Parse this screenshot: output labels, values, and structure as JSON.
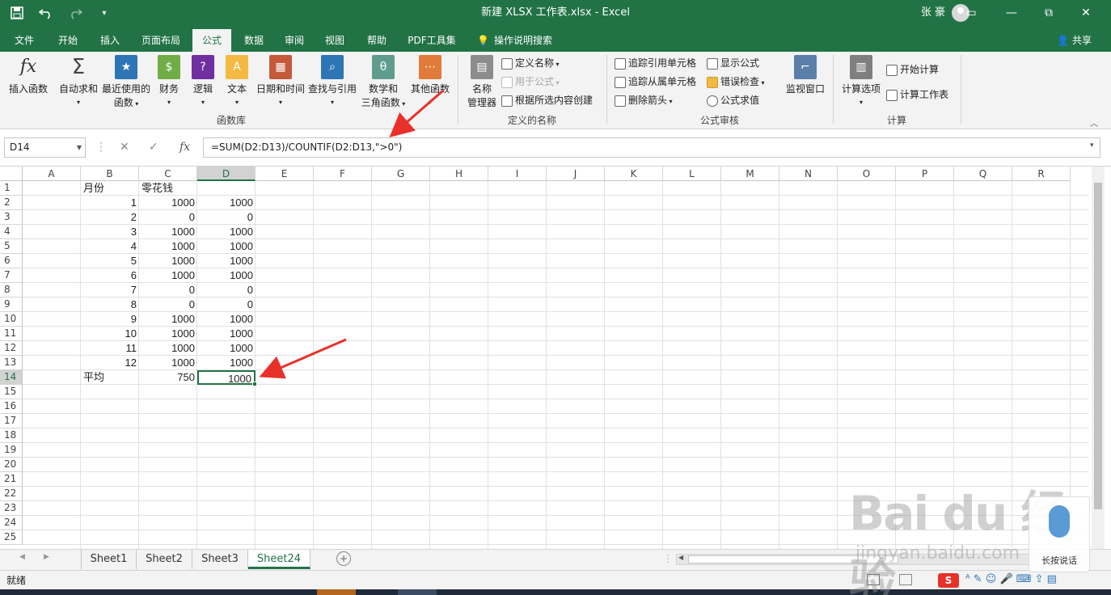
{
  "window": {
    "title": "新建 XLSX 工作表.xlsx  -  Excel",
    "user": "张 豪",
    "minimize": "—",
    "restore": "⧉",
    "close": "✕",
    "ribbon_display": "▭"
  },
  "quick_access": {
    "save_icon": "save-icon",
    "undo_icon": "undo-icon",
    "redo_icon": "redo-icon",
    "customize_icon": "customize-icon"
  },
  "tabs": [
    "文件",
    "开始",
    "插入",
    "页面布局",
    "公式",
    "数据",
    "审阅",
    "视图",
    "帮助",
    "PDF工具集",
    "操作说明搜索"
  ],
  "active_tab": "公式",
  "share": "共享",
  "ribbon": {
    "function_library": {
      "label": "函数库",
      "buttons": [
        "插入函数",
        "自动求和",
        "最近使用的\n函数",
        "财务",
        "逻辑",
        "文本",
        "日期和时间",
        "查找与引用",
        "数学和\n三角函数",
        "其他函数"
      ],
      "insert_function": "插入函数",
      "autosum": "自动求和",
      "recent_1": "最近使用的",
      "recent_2": "函数",
      "financial": "财务",
      "logical": "逻辑",
      "text": "文本",
      "datetime": "日期和时间",
      "lookup": "查找与引用",
      "math_1": "数学和",
      "math_2": "三角函数",
      "more": "其他函数"
    },
    "defined_names": {
      "label": "定义的名称",
      "name_manager_1": "名称",
      "name_manager_2": "管理器",
      "define_name": "定义名称",
      "use_in_formula": "用于公式",
      "create_from_selection": "根据所选内容创建"
    },
    "formula_auditing": {
      "label": "公式审核",
      "trace_precedents": "追踪引用单元格",
      "trace_dependents": "追踪从属单元格",
      "remove_arrows": "删除箭头",
      "show_formulas": "显示公式",
      "error_checking": "错误检查",
      "evaluate_formula": "公式求值",
      "watch_window": "监视窗口"
    },
    "calculation": {
      "label": "计算",
      "calc_options": "计算选项",
      "calc_now": "开始计算",
      "calc_sheet": "计算工作表"
    }
  },
  "formula_bar": {
    "name_box": "D14",
    "fx": "fx",
    "formula": "=SUM(D2:D13)/COUNTIF(D2:D13,\">0\")"
  },
  "columns": [
    "A",
    "B",
    "C",
    "D",
    "E",
    "F",
    "G",
    "H",
    "I",
    "J",
    "K",
    "L",
    "M",
    "N",
    "O",
    "P",
    "Q",
    "R"
  ],
  "rows": [
    "1",
    "2",
    "3",
    "4",
    "5",
    "6",
    "7",
    "8",
    "9",
    "10",
    "11",
    "12",
    "13",
    "14",
    "15",
    "16",
    "17",
    "18",
    "19",
    "20",
    "21",
    "22",
    "23",
    "24",
    "25"
  ],
  "cells": {
    "B1": "月份",
    "C1": "零花钱",
    "B2": "1",
    "C2": "1000",
    "D2": "1000",
    "B3": "2",
    "C3": "0",
    "D3": "0",
    "B4": "3",
    "C4": "1000",
    "D4": "1000",
    "B5": "4",
    "C5": "1000",
    "D5": "1000",
    "B6": "5",
    "C6": "1000",
    "D6": "1000",
    "B7": "6",
    "C7": "1000",
    "D7": "1000",
    "B8": "7",
    "C8": "0",
    "D8": "0",
    "B9": "8",
    "C9": "0",
    "D9": "0",
    "B10": "9",
    "C10": "1000",
    "D10": "1000",
    "B11": "10",
    "C11": "1000",
    "D11": "1000",
    "B12": "11",
    "C12": "1000",
    "D12": "1000",
    "B13": "12",
    "C13": "1000",
    "D13": "1000",
    "B14": "平均",
    "C14": "750",
    "D14": "1000"
  },
  "active_cell": "D14",
  "sheets": [
    "Sheet1",
    "Sheet2",
    "Sheet3",
    "Sheet24"
  ],
  "active_sheet": "Sheet24",
  "status": "就绪",
  "watermark": {
    "brand": "Bai du 经验",
    "url": "jingyan.baidu.com",
    "voice": "长按说话"
  },
  "colors": {
    "excel_green": "#217346",
    "arrow_red": "#e8312a"
  }
}
